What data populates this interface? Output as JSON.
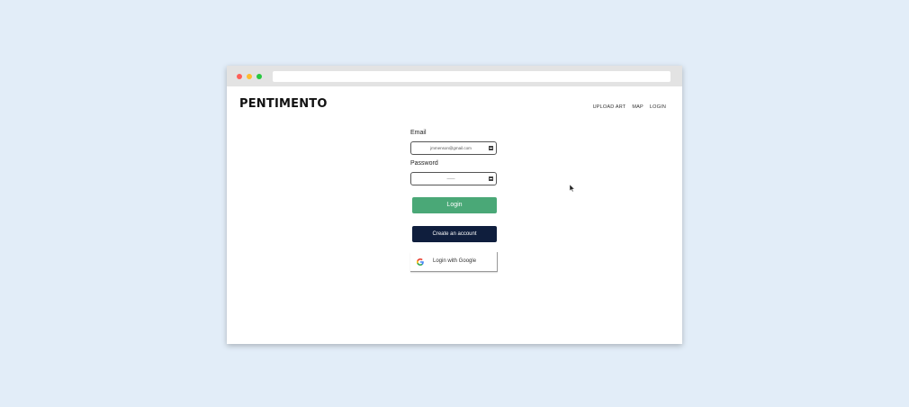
{
  "brand": "PENTIMENTO",
  "nav": {
    "upload": "UPLOAD ART",
    "map": "MAP",
    "login": "LOGIN"
  },
  "form": {
    "email_label": "Email",
    "email_value": "jmmenson@gmail.com",
    "password_label": "Password",
    "password_value": "——",
    "login_button": "Login",
    "create_button": "Create an account",
    "google_button": "Login with Google"
  },
  "colors": {
    "background": "#e2edf8",
    "login_button": "#4aa877",
    "create_button": "#0f1e3d"
  },
  "icons": [
    "password-key-icon",
    "google-icon",
    "mouse-cursor-icon"
  ]
}
